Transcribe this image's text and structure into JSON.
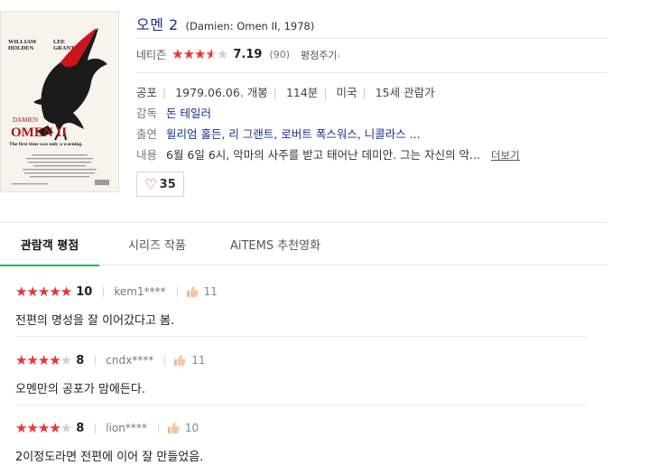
{
  "poster": {
    "credit_left": "WILLIAM\nHOLDEN",
    "credit_right": "LEE\nGRANT",
    "title_small": "DAMIEN",
    "title_big": "OMEN II",
    "tagline": "The first time was only a warning."
  },
  "movie": {
    "title": "오멘 2",
    "subtitle": "(Damien: Omen II,  1978)"
  },
  "rating": {
    "label": "네티즌",
    "stars_fraction": 0.72,
    "score": "7.19",
    "count": "(90)",
    "rate_button": "평점주기"
  },
  "meta": {
    "genre": "공포",
    "release": "1979.06.06. 개봉",
    "runtime": "114분",
    "country": "미국",
    "age": "15세 관람가"
  },
  "director": {
    "label": "감독",
    "value": "돈 테일러"
  },
  "cast": {
    "label": "출연",
    "value": "윌리엄 홀든, 리 그랜트, 로버트 폭스워스, 니콜라스 ..."
  },
  "plot": {
    "label": "내용",
    "value": "6월 6일 6시, 악마의 사주를 받고 태어난 데미안. 그는 자신의 악...",
    "more": "더보기"
  },
  "like": {
    "count": "35"
  },
  "tabs": [
    {
      "label": "관람객 평점"
    },
    {
      "label": "시리즈 작품"
    },
    {
      "label": "AiTEMS 추천영화"
    }
  ],
  "reviews": [
    {
      "stars_fraction": 1.0,
      "score": "10",
      "user": "kem1****",
      "likes": "11",
      "text": "전편의 명성을 잘 이어갔다고 봄."
    },
    {
      "stars_fraction": 0.8,
      "score": "8",
      "user": "cndx****",
      "likes": "11",
      "text": "오멘만의 공포가 맘에든다."
    },
    {
      "stars_fraction": 0.8,
      "score": "8",
      "user": "lion****",
      "likes": "10",
      "text": "2이정도라면 전편에 이어 잘 만들었음."
    }
  ],
  "colors": {
    "star_red": "#e8353a",
    "link_blue": "#16309a",
    "tab_active": "#1fb35a"
  }
}
